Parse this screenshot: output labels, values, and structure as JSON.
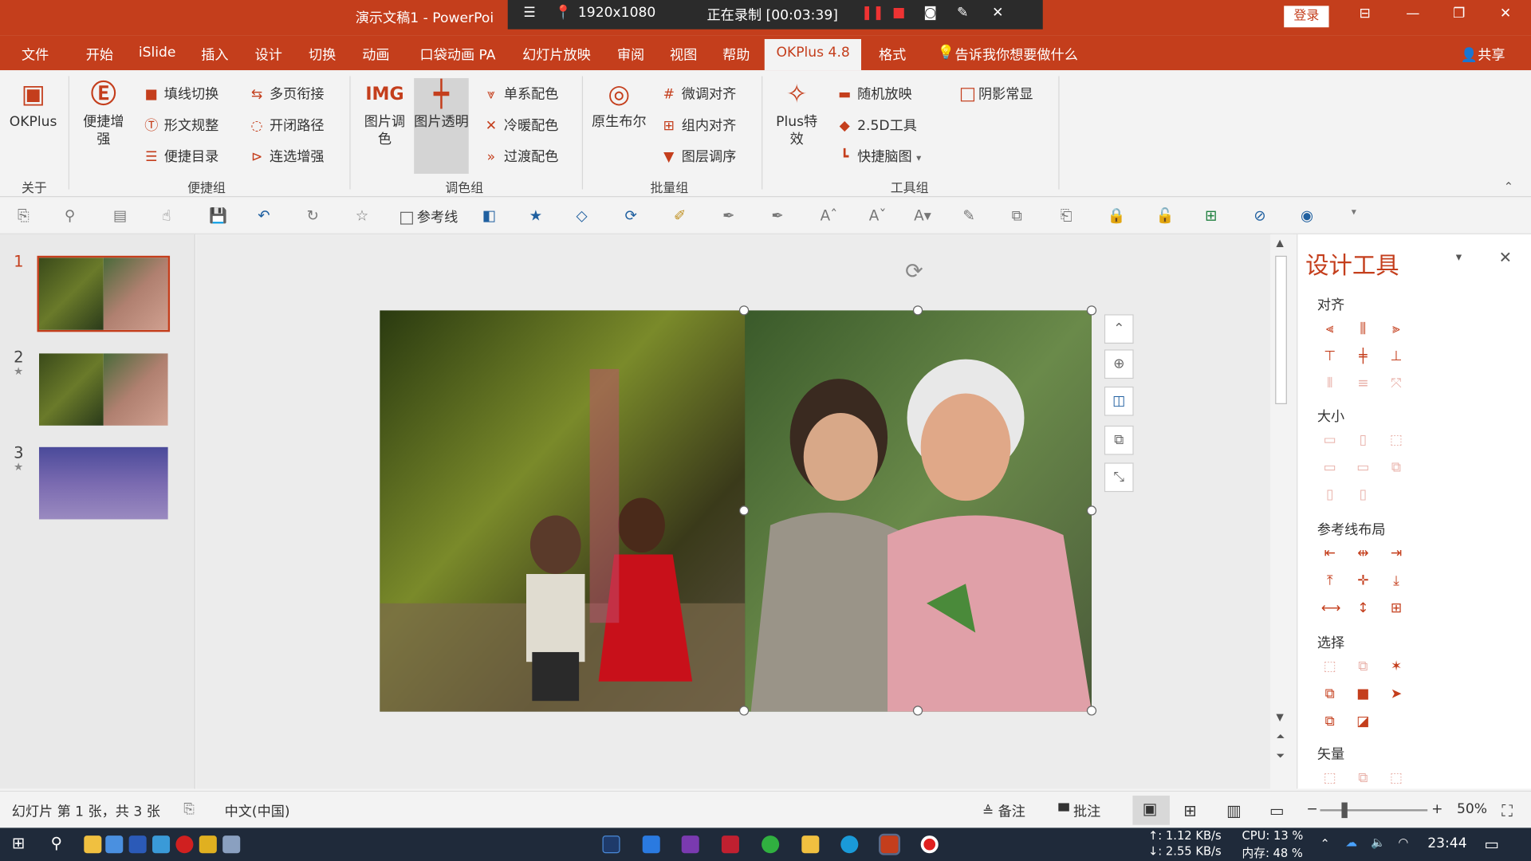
{
  "window": {
    "doc_title": "演示文稿1 - PowerPoi",
    "login": "登录"
  },
  "recorder": {
    "resolution": "1920x1080",
    "status": "正在录制 [00:03:39]"
  },
  "tabs": [
    "文件",
    "开始",
    "iSlide",
    "插入",
    "设计",
    "切换",
    "动画",
    "口袋动画 PA",
    "幻灯片放映",
    "审阅",
    "视图",
    "帮助",
    "OKPlus 4.8",
    "格式"
  ],
  "tell_me": "告诉我你想要做什么",
  "share": "共享",
  "ribbon": {
    "okplus": "OKPlus",
    "about_group": "关于",
    "quick_enhance": "便捷增强",
    "group1": {
      "name": "便捷组",
      "items": [
        "填线切换",
        "形文规整",
        "便捷目录",
        "多页衔接",
        "开闭路径",
        "连选增强"
      ]
    },
    "group2": {
      "name": "调色组",
      "big": [
        "图片调色",
        "图片透明"
      ],
      "items": [
        "单系配色",
        "冷暖配色",
        "过渡配色"
      ]
    },
    "group3": {
      "name": "批量组",
      "big": "原生布尔",
      "items": [
        "微调对齐",
        "组内对齐",
        "图层调序"
      ]
    },
    "group4": {
      "name": "工具组",
      "big": "Plus特效",
      "items": [
        "随机放映",
        "2.5D工具",
        "快捷脑图",
        "阴影常显"
      ]
    }
  },
  "quick_toolbar": {
    "guides": "参考线"
  },
  "slides": [
    {
      "num": "1"
    },
    {
      "num": "2"
    },
    {
      "num": "3"
    }
  ],
  "pane": {
    "title": "设计工具",
    "sections": [
      "对齐",
      "大小",
      "参考线布局",
      "选择",
      "矢量"
    ]
  },
  "status": {
    "slide_info": "幻灯片 第 1 张，共 3 张",
    "language": "中文(中国)",
    "notes": "备注",
    "comments": "批注",
    "zoom": "50%"
  },
  "taskbar": {
    "net_up": "↑: 1.12 KB/s",
    "net_down": "↓: 2.55 KB/s",
    "cpu": "CPU: 13 %",
    "mem": "内存: 48 %",
    "time": "23:44"
  },
  "colors": {
    "accent": "#c43e1c"
  }
}
